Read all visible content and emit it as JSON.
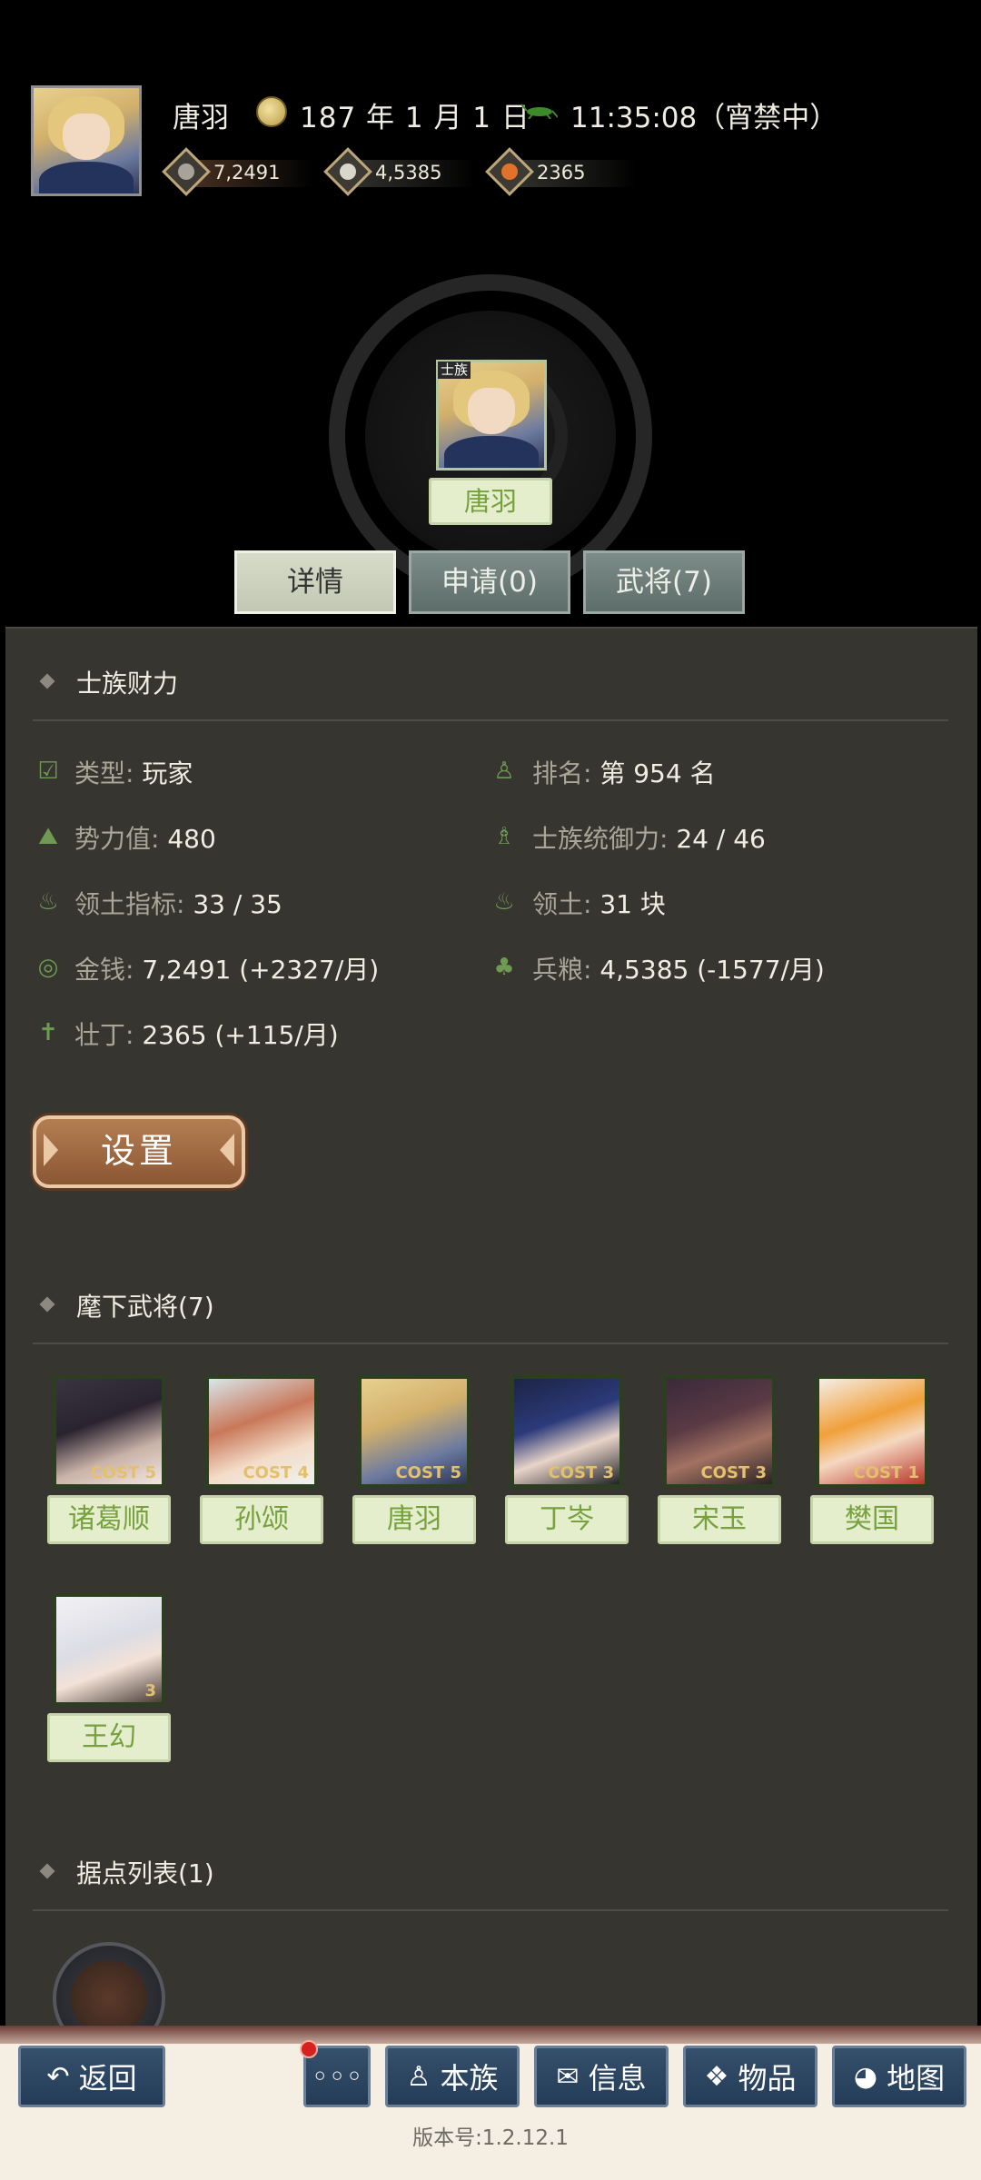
{
  "header": {
    "player_name": "唐羽",
    "date": "187 年 1 月 1 日",
    "time": "11:35:08（宵禁中）",
    "resources": [
      {
        "icon": "coin-icon",
        "value": "7,2491"
      },
      {
        "icon": "grain-icon",
        "value": "4,5385"
      },
      {
        "icon": "population-icon",
        "value": "2365"
      }
    ]
  },
  "clan": {
    "tag": "士族",
    "name": "唐羽"
  },
  "tabs": [
    {
      "label": "详情",
      "active": true
    },
    {
      "label": "申请(0)",
      "active": false
    },
    {
      "label": "武将(7)",
      "active": false
    }
  ],
  "wealth": {
    "title": "士族财力",
    "stats": [
      {
        "icon": "calendar-icon",
        "label": "类型:",
        "value": "玩家"
      },
      {
        "icon": "rank-icon",
        "label": "排名:",
        "value": "第 954 名"
      },
      {
        "icon": "power-icon",
        "label": "势力值:",
        "value": "480"
      },
      {
        "icon": "command-icon",
        "label": "士族统御力:",
        "value": "24 / 46"
      },
      {
        "icon": "territory-target-icon",
        "label": "领土指标:",
        "value": "33 / 35"
      },
      {
        "icon": "territory-icon",
        "label": "领土:",
        "value": "31 块"
      },
      {
        "icon": "money-icon",
        "label": "金钱:",
        "value": "7,2491 (+2327/月)"
      },
      {
        "icon": "grain-stat-icon",
        "label": "兵粮:",
        "value": "4,5385 (-1577/月)"
      },
      {
        "icon": "manpower-icon",
        "label": "壮丁:",
        "value": "2365 (+115/月)"
      }
    ]
  },
  "settings_button": "设置",
  "generals": {
    "title": "麾下武将(7)",
    "list": [
      {
        "name": "诸葛顺",
        "cost": "COST 5"
      },
      {
        "name": "孙颂",
        "cost": "COST 4"
      },
      {
        "name": "唐羽",
        "cost": "COST 5"
      },
      {
        "name": "丁岑",
        "cost": "COST 3"
      },
      {
        "name": "宋玉",
        "cost": "COST 3"
      },
      {
        "name": "樊国",
        "cost": "COST 1"
      },
      {
        "name": "王幻",
        "cost": "3"
      }
    ]
  },
  "strongholds": {
    "title": "据点列表(1)"
  },
  "bottom_nav": {
    "back": "返回",
    "more": "◦◦◦",
    "clan": "本族",
    "info": "信息",
    "items": "物品",
    "map": "地图"
  },
  "version": "版本号:1.2.12.1",
  "colors": {
    "panel_bg": "#363530",
    "accent_green": "#76a13e",
    "nav_blue": "#243c57",
    "settings_brown": "#8b5733"
  }
}
